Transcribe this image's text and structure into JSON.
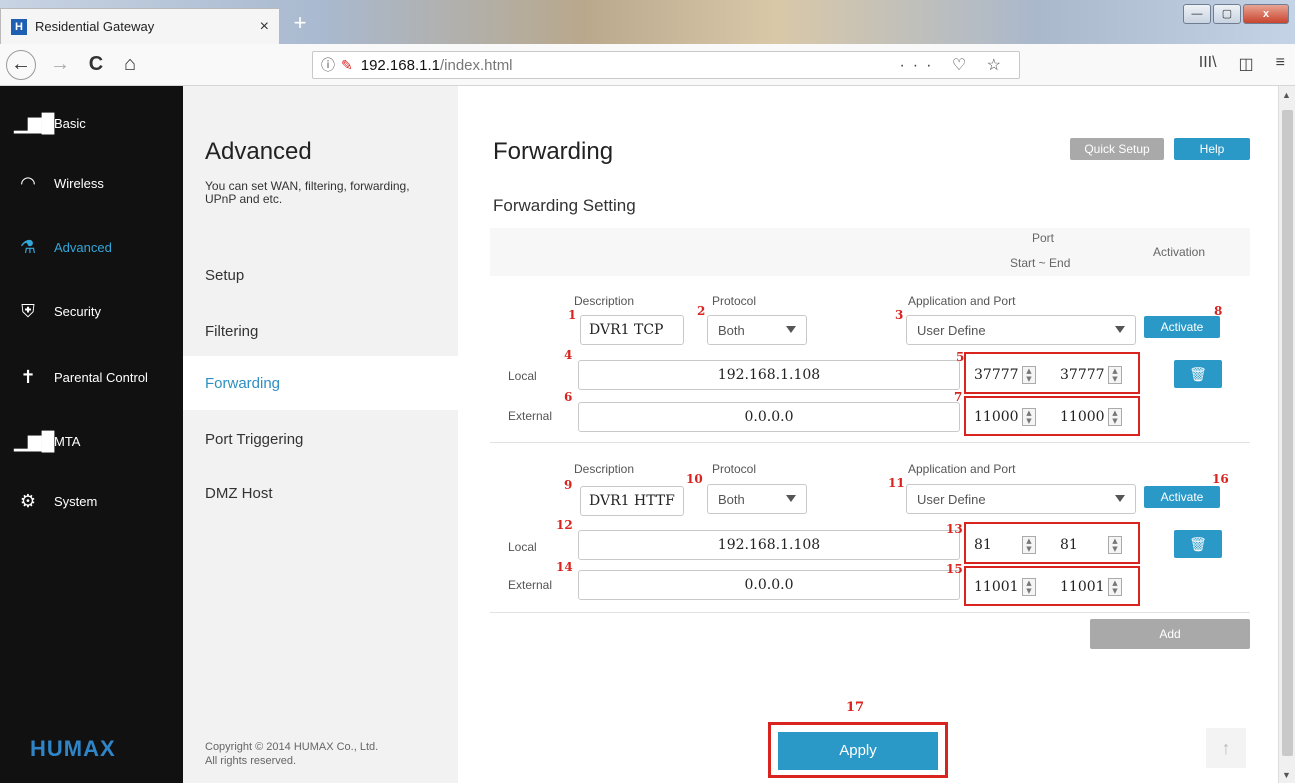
{
  "browser": {
    "tab_title": "Residential Gateway",
    "tab_close": "×",
    "new_tab": "+",
    "favicon": "H",
    "url_host": "192.168.1.1",
    "url_path": "/index.html",
    "url_actions": "··· ♡ ☆",
    "nav_back": "←",
    "nav_forward": "→",
    "nav_reload": "C",
    "nav_home": "⌂",
    "toolbar_icons": [
      "III\\",
      "◫",
      "≡"
    ],
    "win_min": "—",
    "win_max": "▢",
    "win_close": "x"
  },
  "sidebar": {
    "items": [
      {
        "label": "Basic",
        "icon": "bar-chart-icon"
      },
      {
        "label": "Wireless",
        "icon": "wifi-icon"
      },
      {
        "label": "Advanced",
        "icon": "flask-icon"
      },
      {
        "label": "Security",
        "icon": "shield-icon"
      },
      {
        "label": "Parental Control",
        "icon": "family-icon"
      },
      {
        "label": "MTA",
        "icon": "bar-chart-icon"
      },
      {
        "label": "System",
        "icon": "gear-icon"
      }
    ],
    "active": "Advanced",
    "brand": "HUMAX"
  },
  "subnav": {
    "title": "Advanced",
    "description": "You can set WAN, filtering, forwarding, UPnP and etc.",
    "items": [
      "Setup",
      "Filtering",
      "Forwarding",
      "Port Triggering",
      "DMZ Host"
    ],
    "active": "Forwarding",
    "copyright_line1": "Copyright © 2014 HUMAX Co., Ltd.",
    "copyright_line2": "All rights reserved."
  },
  "main": {
    "title": "Forwarding",
    "quick_setup": "Quick Setup",
    "help": "Help",
    "section_title": "Forwarding Setting",
    "header": {
      "port": "Port",
      "start_end": "Start ~ End",
      "activation": "Activation"
    },
    "labels": {
      "description": "Description",
      "protocol": "Protocol",
      "application": "Application and Port",
      "local": "Local",
      "external": "External",
      "activate": "Activate"
    },
    "rules": [
      {
        "description": "DVR1 TCP",
        "protocol": "Both",
        "application": "User Define",
        "local_ip": "192.168.1.108",
        "local_start": "37777",
        "local_end": "37777",
        "external_ip": "0.0.0.0",
        "external_start": "11000",
        "external_end": "11000",
        "markers": {
          "description": "1",
          "protocol": "2",
          "application": "3",
          "local_ip": "4",
          "local_ports": "5",
          "external_ip": "6",
          "external_ports": "7",
          "activate": "8"
        }
      },
      {
        "description": "DVR1 HTTF",
        "protocol": "Both",
        "application": "User Define",
        "local_ip": "192.168.1.108",
        "local_start": "81",
        "local_end": "81",
        "external_ip": "0.0.0.0",
        "external_start": "11001",
        "external_end": "11001",
        "markers": {
          "description": "9",
          "protocol": "10",
          "application": "11",
          "local_ip": "12",
          "local_ports": "13",
          "external_ip": "14",
          "external_ports": "15",
          "activate": "16"
        }
      }
    ],
    "add": "Add",
    "apply": "Apply",
    "apply_marker": "17",
    "to_top": "↑"
  },
  "colors": {
    "accent": "#2b99c7",
    "annotation_red": "#d9231e",
    "sidebar_bg": "#111111",
    "active_link": "#2d8fc1"
  }
}
